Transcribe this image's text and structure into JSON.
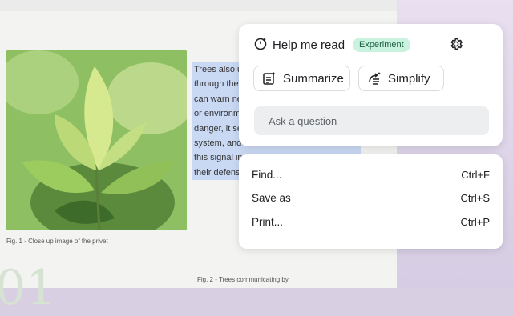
{
  "document": {
    "paragraph_lines": [
      "Trees also us",
      "through thei",
      "can warn ne",
      "or environm",
      "danger, it se",
      "system, and",
      "this signal in",
      "their defens"
    ],
    "caption_1": "Fig. 1 - Close up image of the privet",
    "caption_2": "Fig. 2 - Trees communicating by",
    "big_number": "01"
  },
  "panel": {
    "title": "Help me read",
    "badge": "Experiment",
    "summarize_label": "Summarize",
    "simplify_label": "Simplify",
    "ask_placeholder": "Ask a question"
  },
  "menu": {
    "items": [
      {
        "label": "Find...",
        "shortcut": "Ctrl+F"
      },
      {
        "label": "Save as",
        "shortcut": "Ctrl+S"
      },
      {
        "label": "Print...",
        "shortcut": "Ctrl+P"
      }
    ]
  },
  "colors": {
    "badge_bg": "#c9f2df",
    "highlight": "#c9d8f3",
    "leaf_green": "#6e9f45"
  }
}
